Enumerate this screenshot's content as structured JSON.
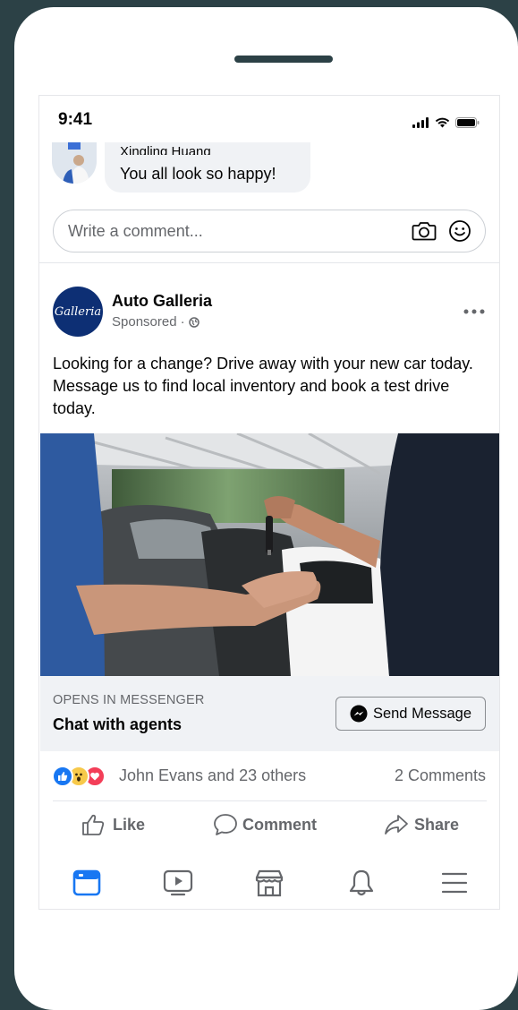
{
  "status": {
    "time": "9:41"
  },
  "comment": {
    "author": "Xingling Huang",
    "text": "You all look so happy!",
    "input_placeholder": "Write a comment..."
  },
  "post": {
    "page_name": "Auto Galleria",
    "logo_text": "Galleria",
    "sponsored": "Sponsored",
    "caption": "Looking for a change? Drive away with your new car today. Message us to find local inventory and book a test drive today.",
    "cta": {
      "opens_in": "OPENS IN MESSENGER",
      "headline": "Chat with agents",
      "button_label": "Send Message"
    },
    "reactions_text": "John Evans and 23 others",
    "comments_count": "2 Comments",
    "actions": {
      "like": "Like",
      "comment": "Comment",
      "share": "Share"
    }
  },
  "colors": {
    "background": "#2c4146",
    "brand_blue": "#1877f2",
    "text_secondary": "#65676b"
  },
  "bottom_nav": [
    "news-feed-icon",
    "watch-icon",
    "marketplace-icon",
    "notifications-icon",
    "menu-icon"
  ]
}
